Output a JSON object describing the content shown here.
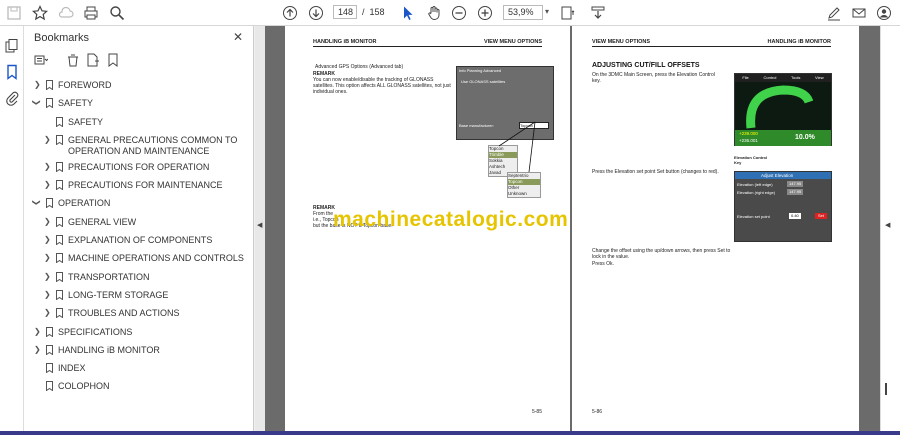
{
  "toolbar": {
    "page_current": "148",
    "page_separator": "/",
    "page_total": "158",
    "zoom": "53,9%"
  },
  "bookmarks_panel": {
    "title": "Bookmarks",
    "items": [
      {
        "label": "FOREWORD",
        "expanded": false
      },
      {
        "label": "SAFETY",
        "expanded": true
      },
      {
        "label": "SAFETY"
      },
      {
        "label": "GENERAL PRECAUTIONS COMMON TO",
        "label2": "OPERATION AND MAINTENANCE"
      },
      {
        "label": "PRECAUTIONS FOR OPERATION"
      },
      {
        "label": "PRECAUTIONS FOR MAINTENANCE"
      },
      {
        "label": "OPERATION",
        "expanded": true
      },
      {
        "label": "GENERAL VIEW"
      },
      {
        "label": "EXPLANATION OF COMPONENTS"
      },
      {
        "label": "MACHINE OPERATIONS AND CONTROLS"
      },
      {
        "label": "TRANSPORTATION"
      },
      {
        "label": "LONG-TERM STORAGE"
      },
      {
        "label": "TROUBLES AND ACTIONS"
      },
      {
        "label": "SPECIFICATIONS"
      },
      {
        "label": "HANDLING iB MONITOR"
      },
      {
        "label": "INDEX"
      },
      {
        "label": "COLOPHON"
      }
    ]
  },
  "page_left": {
    "header_left": "HANDLING iB MONITOR",
    "header_right": "VIEW MENU OPTIONS",
    "bullet": "Advanced GPS Options (Advanced tab)",
    "remark1_title": "REMARK",
    "remark1_text": "You can now enable/disable the tracking of GLONASS satellites. This option affects ALL GLONASS satellites, not just individual ones.",
    "dialog_tabs": "Info  Planning  Advanced",
    "dialog_option": "Use GLONASS satellites",
    "dialog_label": "Base manufacturer:",
    "dialog_value": "Topcon",
    "list1": [
      "Topcon",
      "Trimble",
      "Sokkia",
      "Ashtech",
      "Javad"
    ],
    "list2": [
      "Septentrio",
      "Topcon",
      "Other",
      "Unknown"
    ],
    "remark2_title": "REMARK",
    "remark2_text_a": "From the",
    "remark2_text_b": "i.e., Topcon",
    "remark2_text_c": "but the base is NOT a Topcon base.",
    "page_number": "5-85"
  },
  "page_right": {
    "header_left": "VIEW MENU OPTIONS",
    "header_right": "HANDLING iB MONITOR",
    "section_title": "ADJUSTING CUT/FILL OFFSETS",
    "step1": "On the 3DMC Main Screen, press the Elevation Control key.",
    "screen_menu": [
      "File",
      "Control",
      "Tools",
      "View"
    ],
    "screen_values": [
      "+239.000",
      "+236.001",
      "10.0%"
    ],
    "callout": "Elevation Control Key",
    "step2": "Press the Elevation set point Set button (changes to red).",
    "adj_title": "Adjust Elevation",
    "adj_left": "Elevation (left edge)",
    "adj_right": "Elevation (right edge)",
    "adj_left_val": "147.95",
    "adj_right_val": "147.95",
    "adj_setpoint": "Elevation set point",
    "adj_setpoint_val": "0.40",
    "adj_set": "Set",
    "step3": "Change the offset using the up/down arrows, then press Set to lock in the value.",
    "step4": "Press Ok.",
    "page_number": "5-86"
  },
  "watermark": "machinecatalogic.com"
}
